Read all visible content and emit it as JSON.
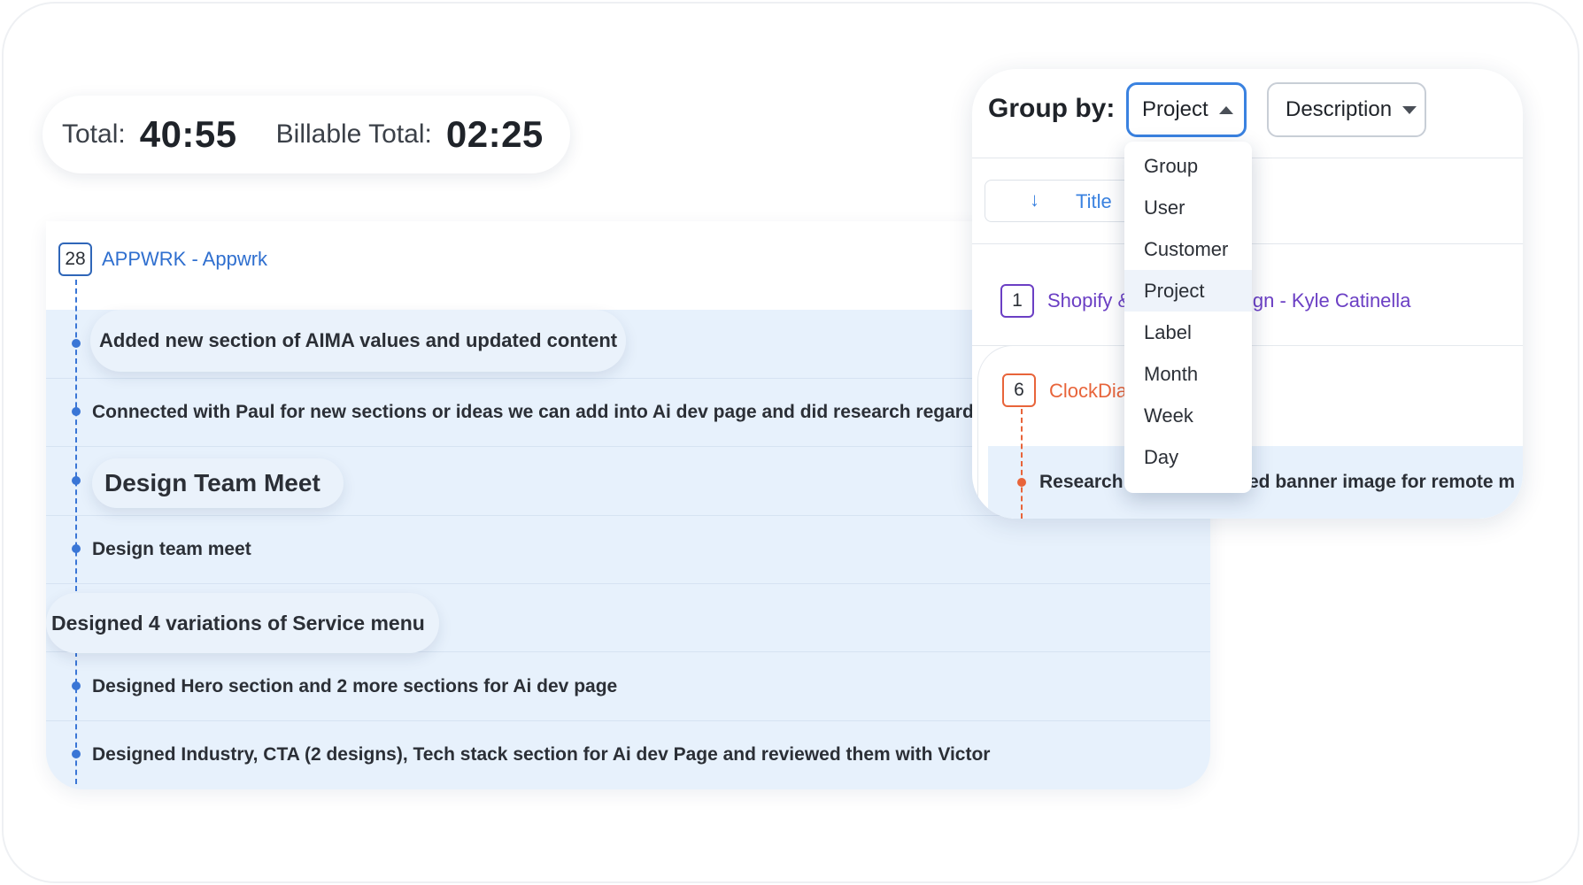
{
  "totals": {
    "total_label": "Total:",
    "total_value": "40:55",
    "billable_label": "Billable Total:",
    "billable_value": "02:25"
  },
  "timeline": {
    "badge": "28",
    "project": "APPWRK - Appwrk",
    "entries": [
      {
        "text": "Added new section of AIMA values and updated content"
      },
      {
        "text": "Connected with Paul for new sections or ideas we can add into Ai dev page and did research regarding h"
      },
      {
        "text": "Design Team Meet"
      },
      {
        "text": "Design team meet"
      },
      {
        "text": "Designed 4 variations of Service menu"
      },
      {
        "text": "Designed Hero section and 2 more sections for Ai dev page"
      },
      {
        "text": "Designed Industry, CTA (2 designs), Tech stack section for Ai dev Page and reviewed them with Victor"
      }
    ]
  },
  "group_by": {
    "label": "Group by:",
    "selected": "Project",
    "second_select": "Description",
    "sort": {
      "arrow": "↓",
      "title": "Title"
    },
    "rows": [
      {
        "badge": "1",
        "left_text": "Shopify &",
        "right_text": "ign - Kyle Catinella"
      },
      {
        "badge": "6",
        "left_text": "ClockDia"
      }
    ],
    "entry_left": "Research",
    "entry_right": "ed banner image for remote m"
  },
  "dropdown": {
    "options": [
      "Group",
      "User",
      "Customer",
      "Project",
      "Label",
      "Month",
      "Week",
      "Day"
    ],
    "selected_index": 3
  },
  "colors": {
    "accent_blue": "#3a76d6",
    "link_blue": "#2f6fcf",
    "purple": "#6b3fc4",
    "orange": "#e8643a",
    "row_bg": "#e7f1fc"
  }
}
